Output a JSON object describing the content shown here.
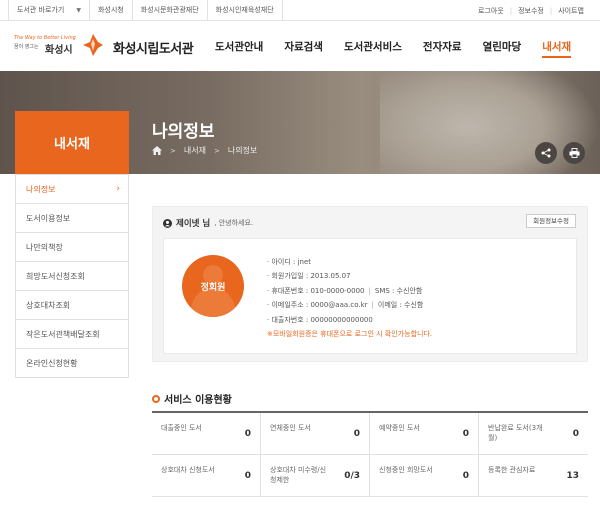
{
  "topbar": {
    "shortcut_label": "도서관 바로가기",
    "links": [
      "화성시청",
      "화성시문화관광재단",
      "화성시인재육성재단"
    ],
    "right_links": [
      "로그아웃",
      "정보수정",
      "사이트맵"
    ]
  },
  "header": {
    "slogan": "The Way to Better Living",
    "slogan_sub": "꿈이 영그는",
    "city": "화성시",
    "library_name": "화성시립도서관",
    "nav": [
      "도서관안내",
      "자료검색",
      "도서관서비스",
      "전자자료",
      "열린마당",
      "내서재"
    ]
  },
  "banner": {
    "title": "나의정보",
    "breadcrumb": [
      "내서재",
      "나의정보"
    ]
  },
  "sidebar": {
    "title": "내서재",
    "items": [
      "나의정보",
      "도서이용정보",
      "나만의책장",
      "희망도서신청조회",
      "상호대차조회",
      "작은도서관책배달조회",
      "온라인신청현황"
    ]
  },
  "profile": {
    "user_name": "제이넷 님",
    "greeting": ", 안녕하세요.",
    "edit_button": "회원정보수정",
    "badge": "정회원",
    "id_line": "· 아이디 : jnet",
    "join_line": "· 회원가입일 : 2013.05.07",
    "phone_line": "· 휴대폰번호 : 010-0000-0000",
    "sms_line": "SMS : 수신안함",
    "email_line": "· 이메일주소 : 0000@aaa.co.kr",
    "email_recv": "이메일 : 수신함",
    "card_line": "· 대출자번호 : 00000000000000",
    "notice": "※모바일회원증은 휴대폰으로 로그인 시 확인가능합니다."
  },
  "services": {
    "title": "서비스 이용현황",
    "cells": [
      {
        "label": "대출중인 도서",
        "value": "0"
      },
      {
        "label": "연체중인 도서",
        "value": "0"
      },
      {
        "label": "예약중인 도서",
        "value": "0"
      },
      {
        "label": "반납완료 도서(3개월)",
        "value": "0"
      },
      {
        "label": "상호대차 신청도서",
        "value": "0"
      },
      {
        "label": "상호대차 미수령/신청제한",
        "value": "0/3"
      },
      {
        "label": "신청중인 희망도서",
        "value": "0"
      },
      {
        "label": "등록한 관심자료",
        "value": "13"
      }
    ]
  },
  "colors": {
    "accent": "#e8661d"
  }
}
